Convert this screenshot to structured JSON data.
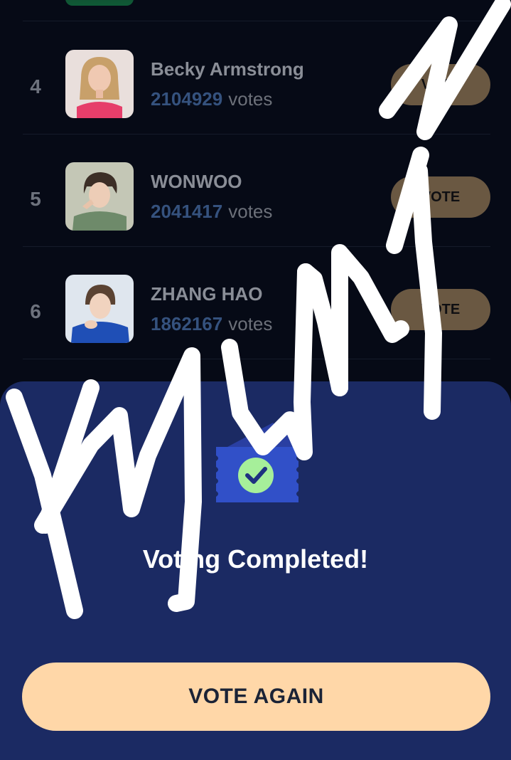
{
  "leaderboard": {
    "rows": [
      {
        "rank": "4",
        "name": "Becky Armstrong",
        "votes": "2104929",
        "votes_word": "votes",
        "button": "VOTE"
      },
      {
        "rank": "5",
        "name": "WONWOO",
        "votes": "2041417",
        "votes_word": "votes",
        "button": "VOTE"
      },
      {
        "rank": "6",
        "name": "ZHANG HAO",
        "votes": "1862167",
        "votes_word": "votes",
        "button": "VOTE"
      }
    ]
  },
  "completion_sheet": {
    "title": "Voting Completed!",
    "vote_again_label": "VOTE AGAIN"
  },
  "colors": {
    "background": "#060a16",
    "sheet": "#1b2a63",
    "accent_button": "#ffd7a8",
    "vote_button": "#6a5842",
    "vote_count": "#35527e",
    "ticket": "#3150c8",
    "check": "#a6ef9a"
  },
  "icons": {
    "ticket": "ticket-icon",
    "check": "check-circle-icon"
  }
}
